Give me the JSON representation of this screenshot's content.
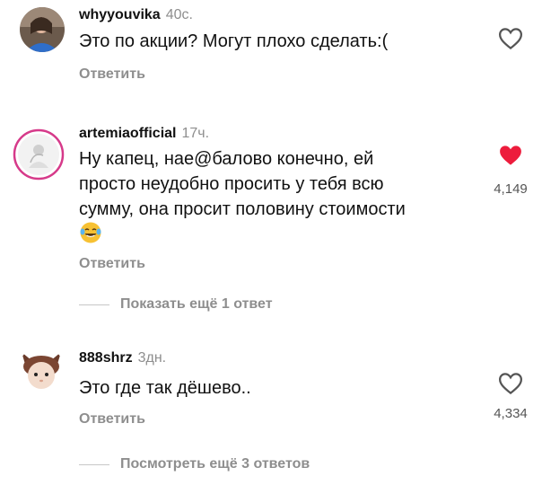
{
  "comments": [
    {
      "username": "whyyouvika",
      "time": "40с.",
      "text_lines": [
        "Это по акции? Могут плохо сделать:("
      ],
      "reply_label": "Ответить",
      "liked": false
    },
    {
      "username": "artemiaofficial",
      "time": "17ч.",
      "text_lines": [
        "Ну капец, нае@балово конечно,  ей",
        "просто неудобно просить у тебя всю",
        "сумму,  она просит половину стоимости"
      ],
      "emoji": "face-with-tears-of-joy-icon",
      "reply_label": "Ответить",
      "liked": true,
      "like_count": "4,149",
      "more_replies": "Показать ещё 1 ответ"
    },
    {
      "username": "888shrz",
      "time": "3дн.",
      "text_lines": [
        "Это где так дёшево.."
      ],
      "reply_label": "Ответить",
      "liked": false,
      "like_count": "4,334",
      "more_replies": "Посмотреть ещё 3 ответов"
    }
  ],
  "colors": {
    "heart_liked": "#ed1c3c",
    "muted_text": "#8e8e8e",
    "story_ring": "#e1306c"
  }
}
